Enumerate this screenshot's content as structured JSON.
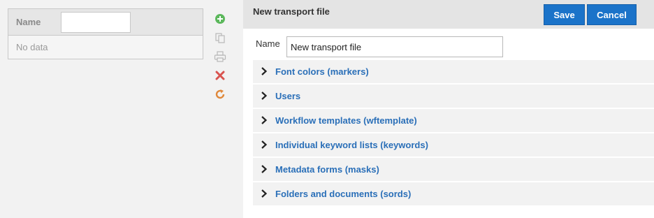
{
  "grid": {
    "column_name": "Name",
    "filter_value": "",
    "empty_text": "No data"
  },
  "toolbar": {
    "icons": [
      "add-icon",
      "copy-icon",
      "print-icon",
      "delete-icon",
      "refresh-icon"
    ]
  },
  "editor": {
    "title": "New transport file",
    "save_label": "Save",
    "cancel_label": "Cancel",
    "name_label": "Name",
    "name_value": "New transport file",
    "sections": [
      {
        "label": "Font colors (markers)"
      },
      {
        "label": "Users"
      },
      {
        "label": "Workflow templates (wftemplate)"
      },
      {
        "label": "Individual keyword lists (keywords)"
      },
      {
        "label": "Metadata forms (masks)"
      },
      {
        "label": "Folders and documents (sords)"
      }
    ]
  },
  "colors": {
    "accent": "#1b73c9",
    "link": "#2a6fb8",
    "add_icon": "#5cb85c",
    "delete_icon": "#d9534f",
    "refresh_icon": "#e0883a"
  }
}
